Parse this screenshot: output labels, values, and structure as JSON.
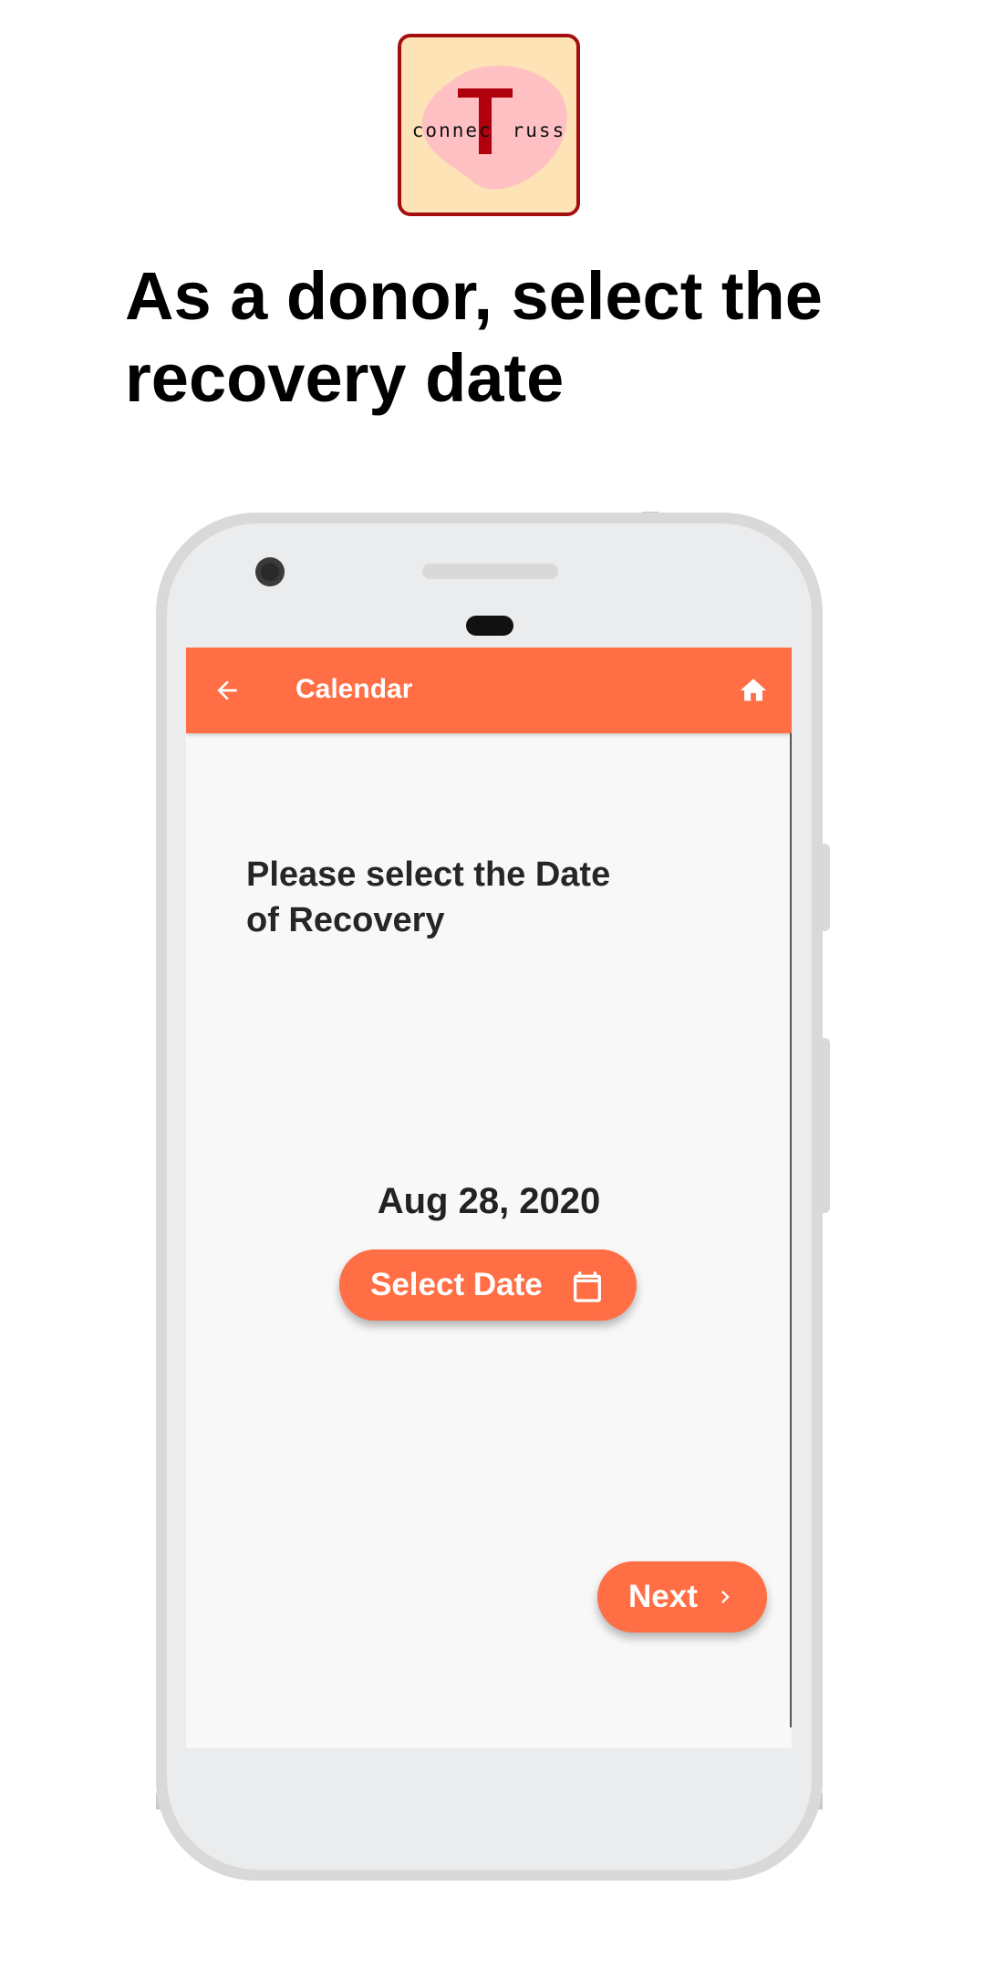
{
  "logo": {
    "text_left": "connec",
    "text_right": "russ",
    "letter": "T"
  },
  "headline": "As a donor, select the recovery date",
  "app": {
    "title": "Calendar",
    "prompt": "Please select the Date of Recovery",
    "date_value": "Aug 28, 2020",
    "select_button_label": "Select Date",
    "next_button_label": "Next"
  },
  "colors": {
    "accent": "#ff6e44",
    "logo_border": "#a30f0f",
    "logo_bg": "#fde3b5",
    "logo_blob": "#ffc0c4"
  },
  "icons": {
    "back": "arrow-left-icon",
    "home": "home-icon",
    "calendar": "calendar-icon",
    "next": "chevron-right-icon"
  }
}
